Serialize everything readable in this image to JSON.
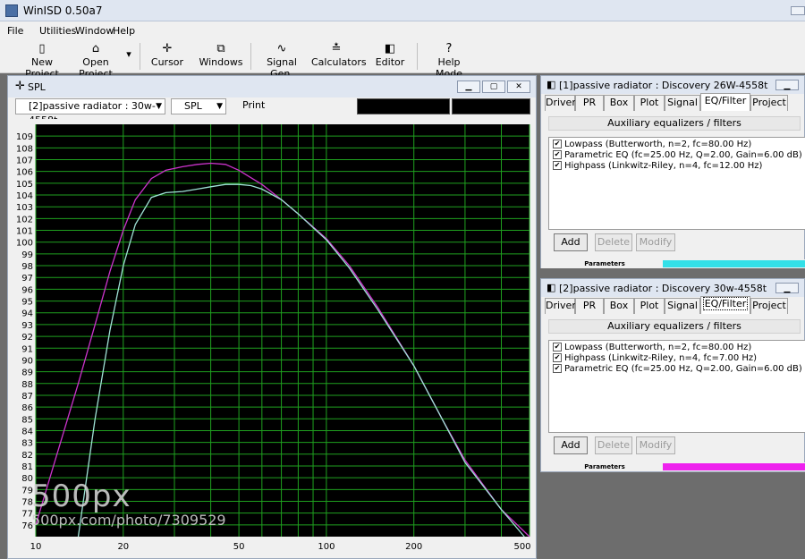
{
  "app": {
    "title": "WinISD 0.50a7"
  },
  "menu": [
    "File",
    "Utilities",
    "Window",
    "Help"
  ],
  "toolbar": {
    "new_project": "New Project",
    "open_project": "Open Project",
    "cursor": "Cursor",
    "windows": "Windows",
    "signal_gen": "Signal Gen.",
    "calculators": "Calculators",
    "editor": "Editor",
    "help_mode": "Help Mode"
  },
  "spl_window": {
    "title": "SPL",
    "project_select": "[2]passive radiator : 30w-4558t",
    "graph_select": "SPL",
    "print_label": "Print"
  },
  "chart_data": {
    "type": "line",
    "x_scale": "log",
    "xlim": [
      10,
      500
    ],
    "ylim": [
      75,
      110
    ],
    "x_ticks": [
      "10",
      "20",
      "50",
      "100",
      "200",
      "500"
    ],
    "y_ticks": [
      "76",
      "77",
      "78",
      "79",
      "80",
      "81",
      "82",
      "83",
      "84",
      "85",
      "86",
      "87",
      "88",
      "89",
      "90",
      "91",
      "92",
      "93",
      "94",
      "95",
      "96",
      "97",
      "98",
      "99",
      "100",
      "101",
      "102",
      "103",
      "104",
      "105",
      "106",
      "107",
      "108",
      "109"
    ],
    "grid": true,
    "background": "#000000",
    "grid_color": "#1fa01f",
    "series": [
      {
        "color": "#cc33cc",
        "x": [
          10,
          12,
          14,
          16,
          18,
          20,
          22,
          25,
          28,
          32,
          36,
          40,
          45,
          50,
          60,
          70,
          80,
          100,
          120,
          150,
          200,
          250,
          300,
          400,
          500
        ],
        "y": [
          76,
          82.5,
          88,
          93,
          97.5,
          101,
          103.6,
          105.4,
          106.1,
          106.4,
          106.6,
          106.7,
          106.6,
          106.1,
          104.9,
          103.6,
          102.4,
          100.3,
          98,
          94.5,
          89.5,
          85,
          81.5,
          77.3,
          74.5
        ]
      },
      {
        "color": "#9fe2d6",
        "x": [
          14,
          16,
          18,
          20,
          22,
          25,
          28,
          32,
          36,
          40,
          45,
          50,
          55,
          60,
          70,
          80,
          100,
          120,
          150,
          200,
          250,
          300,
          400,
          480
        ],
        "y": [
          75,
          85,
          92.5,
          98,
          101.5,
          103.8,
          104.2,
          104.3,
          104.5,
          104.7,
          104.9,
          104.9,
          104.8,
          104.5,
          103.6,
          102.4,
          100.2,
          97.8,
          94.3,
          89.5,
          85,
          81.3,
          77.3,
          75
        ]
      }
    ]
  },
  "panel1": {
    "title": "[1]passive radiator : Discovery 26W-4558t",
    "tabs": [
      "Driver",
      "PR",
      "Box",
      "Plot",
      "Signal",
      "EQ/Filter",
      "Project"
    ],
    "aux_label": "Auxiliary equalizers / filters",
    "filters": [
      "Lowpass (Butterworth, n=2, fc=80.00 Hz)",
      "Parametric EQ (fc=25.00 Hz, Q=2.00, Gain=6.00 dB)",
      "Highpass (Linkwitz-Riley, n=4, fc=12.00 Hz)"
    ],
    "buttons": {
      "add": "Add",
      "delete": "Delete",
      "modify": "Modify"
    },
    "status_label": "Parameters",
    "color": "#33e0e8"
  },
  "panel2": {
    "title": "[2]passive radiator : Discovery 30w-4558t",
    "tabs": [
      "Driver",
      "PR",
      "Box",
      "Plot",
      "Signal",
      "EQ/Filter",
      "Project"
    ],
    "aux_label": "Auxiliary equalizers / filters",
    "filters": [
      "Lowpass (Butterworth, n=2, fc=80.00 Hz)",
      "Highpass (Linkwitz-Riley, n=4, fc=7.00 Hz)",
      "Parametric EQ (fc=25.00 Hz, Q=2.00, Gain=6.00 dB)"
    ],
    "buttons": {
      "add": "Add",
      "delete": "Delete",
      "modify": "Modify"
    },
    "status_label": "Parameters",
    "color": "#ee22ee"
  },
  "watermark": {
    "brand": "500px",
    "url": "500px.com/photo/7309529"
  }
}
